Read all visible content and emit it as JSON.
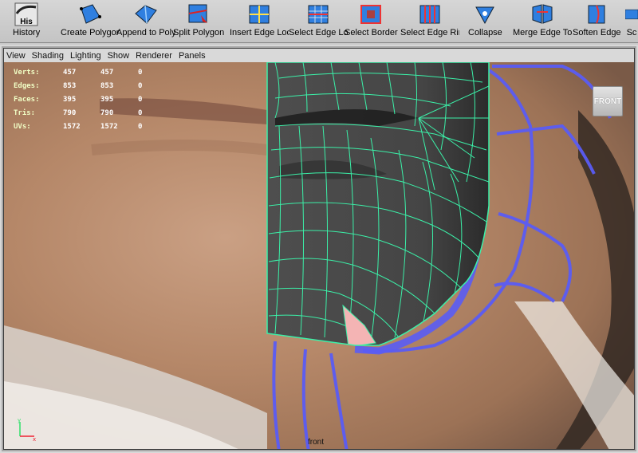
{
  "shelf": {
    "tools": [
      {
        "label": "History",
        "icon": "history-icon"
      },
      {
        "label": "Create Polygon",
        "icon": "create-polygon-icon"
      },
      {
        "label": "Append to Polygon",
        "icon": "append-polygon-icon"
      },
      {
        "label": "Split Polygon",
        "icon": "split-polygon-icon"
      },
      {
        "label": "Insert Edge Loop",
        "icon": "insert-edge-loop-icon"
      },
      {
        "label": "Select Edge Loop",
        "icon": "select-edge-loop-icon"
      },
      {
        "label": "Select Border",
        "icon": "select-border-icon"
      },
      {
        "label": "Select Edge Ring",
        "icon": "select-edge-ring-icon"
      },
      {
        "label": "Collapse",
        "icon": "collapse-icon"
      },
      {
        "label": "Merge Edge Tool",
        "icon": "merge-edge-icon"
      },
      {
        "label": "Soften Edge",
        "icon": "soften-edge-icon"
      },
      {
        "label": "Sc",
        "icon": "sculpt-icon"
      }
    ],
    "history_badge": "His"
  },
  "panel_menu": [
    "View",
    "Shading",
    "Lighting",
    "Show",
    "Renderer",
    "Panels"
  ],
  "hud": [
    {
      "key": "Verts:",
      "a": "457",
      "b": "457",
      "c": "0"
    },
    {
      "key": "Edges:",
      "a": "853",
      "b": "853",
      "c": "0"
    },
    {
      "key": "Faces:",
      "a": "395",
      "b": "395",
      "c": "0"
    },
    {
      "key": "Tris:",
      "a": "790",
      "b": "790",
      "c": "0"
    },
    {
      "key": "UVs:",
      "a": "1572",
      "b": "1572",
      "c": "0"
    }
  ],
  "view_cube_label": "FRONT",
  "camera_label": "front",
  "colors": {
    "wire": "#3bf0a8",
    "mesh": "#4a4a4a",
    "border_edge": "#5b5bff",
    "selected_face": "#f4b4b4"
  }
}
